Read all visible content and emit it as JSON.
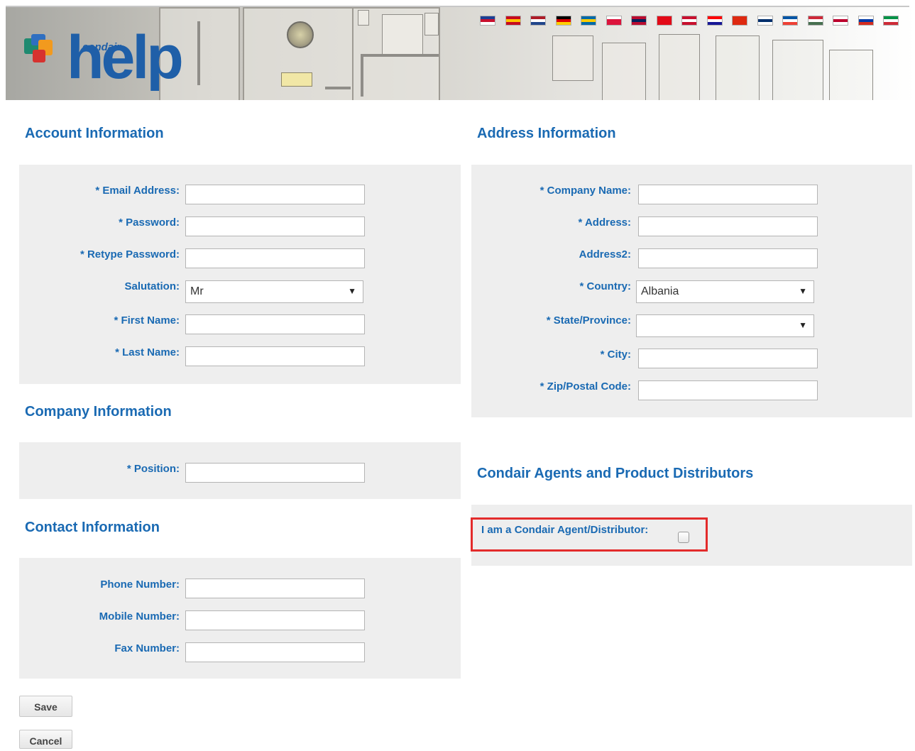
{
  "header": {
    "brand_tag": "condair",
    "brand_logo": "help",
    "flags": [
      {
        "icon": "flag-uk-icon",
        "colors": [
          "#1c3f94",
          "#c8102e",
          "#ffffff"
        ]
      },
      {
        "icon": "flag-spain-icon",
        "colors": [
          "#c60b1e",
          "#ffc400",
          "#c60b1e"
        ]
      },
      {
        "icon": "flag-netherlands-icon",
        "colors": [
          "#ae1c28",
          "#ffffff",
          "#21468b"
        ]
      },
      {
        "icon": "flag-germany-icon",
        "colors": [
          "#000000",
          "#dd0000",
          "#ffce00"
        ]
      },
      {
        "icon": "flag-sweden-icon",
        "colors": [
          "#006aa7",
          "#fecc00",
          "#006aa7"
        ]
      },
      {
        "icon": "flag-poland-icon",
        "colors": [
          "#ffffff",
          "#dc143c",
          "#dc143c"
        ]
      },
      {
        "icon": "flag-norway-icon",
        "colors": [
          "#ba0c2f",
          "#00205b",
          "#ba0c2f"
        ]
      },
      {
        "icon": "flag-turkey-icon",
        "colors": [
          "#e30a17",
          "#e30a17",
          "#e30a17"
        ]
      },
      {
        "icon": "flag-denmark-icon",
        "colors": [
          "#c8102e",
          "#ffffff",
          "#c8102e"
        ]
      },
      {
        "icon": "flag-croatia-icon",
        "colors": [
          "#ff0000",
          "#ffffff",
          "#171796"
        ]
      },
      {
        "icon": "flag-china-icon",
        "colors": [
          "#de2910",
          "#de2910",
          "#de2910"
        ]
      },
      {
        "icon": "flag-finland-icon",
        "colors": [
          "#ffffff",
          "#002f6c",
          "#ffffff"
        ]
      },
      {
        "icon": "flag-france-icon",
        "colors": [
          "#0055a4",
          "#ffffff",
          "#ef4135"
        ]
      },
      {
        "icon": "flag-hungary-icon",
        "colors": [
          "#ce2939",
          "#ffffff",
          "#477050"
        ]
      },
      {
        "icon": "flag-japan-icon",
        "colors": [
          "#ffffff",
          "#bc002d",
          "#ffffff"
        ]
      },
      {
        "icon": "flag-russia-icon",
        "colors": [
          "#ffffff",
          "#0039a6",
          "#d52b1e"
        ]
      },
      {
        "icon": "flag-italy-icon",
        "colors": [
          "#009246",
          "#ffffff",
          "#ce2b37"
        ]
      }
    ]
  },
  "account": {
    "title": "Account Information",
    "email_label": "* Email Address:",
    "email_value": "",
    "password_label": "* Password:",
    "password_value": "",
    "retype_label": "* Retype Password:",
    "retype_value": "",
    "salutation_label": "Salutation:",
    "salutation_value": "Mr",
    "first_name_label": "* First Name:",
    "first_name_value": "",
    "last_name_label": "* Last Name:",
    "last_name_value": ""
  },
  "company": {
    "title": "Company Information",
    "position_label": "* Position:",
    "position_value": ""
  },
  "contact": {
    "title": "Contact Information",
    "phone_label": "Phone Number:",
    "phone_value": "",
    "mobile_label": "Mobile Number:",
    "mobile_value": "",
    "fax_label": "Fax Number:",
    "fax_value": ""
  },
  "address": {
    "title": "Address Information",
    "company_name_label": "* Company Name:",
    "company_name_value": "",
    "address_label": "* Address:",
    "address_value": "",
    "address2_label": "Address2:",
    "address2_value": "",
    "country_label": "* Country:",
    "country_value": "Albania",
    "state_label": "* State/Province:",
    "state_value": "",
    "city_label": "* City:",
    "city_value": "",
    "zip_label": "* Zip/Postal Code:",
    "zip_value": ""
  },
  "agents": {
    "title": "Condair Agents and Product Distributors",
    "checkbox_label": "I am a Condair Agent/Distributor:",
    "checked": false
  },
  "actions": {
    "save_label": "Save",
    "cancel_label": "Cancel"
  },
  "colors": {
    "accent": "#1a6ab3",
    "panel": "#eeeeee",
    "highlight": "#e32b2b"
  }
}
